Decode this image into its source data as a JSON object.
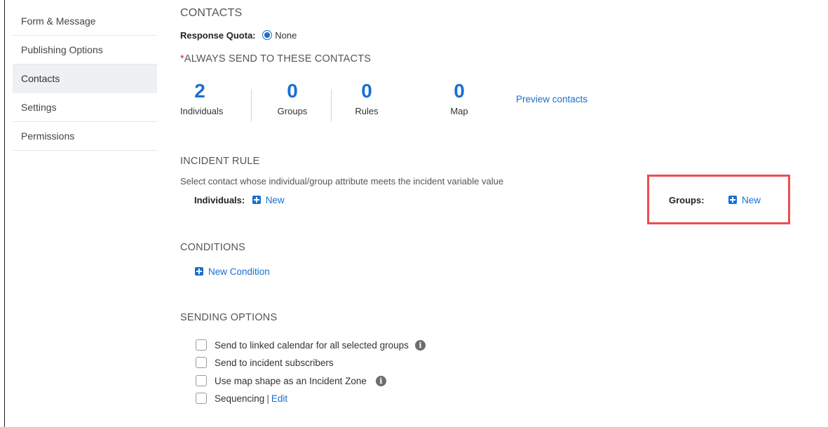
{
  "sidebar": {
    "items": [
      {
        "label": "Form & Message",
        "active": false
      },
      {
        "label": "Publishing Options",
        "active": false
      },
      {
        "label": "Contacts",
        "active": true
      },
      {
        "label": "Settings",
        "active": false
      },
      {
        "label": "Permissions",
        "active": false
      }
    ]
  },
  "contacts": {
    "title": "CONTACTS",
    "response_quota_label": "Response Quota:",
    "response_quota_value": "None"
  },
  "always_send": {
    "required_mark": "*",
    "title": "ALWAYS SEND TO THESE CONTACTS",
    "stats": [
      {
        "value": "2",
        "label": "Individuals"
      },
      {
        "value": "0",
        "label": "Groups"
      },
      {
        "value": "0",
        "label": "Rules"
      },
      {
        "value": "0",
        "label": "Map"
      }
    ],
    "preview_link": "Preview contacts"
  },
  "incident_rule": {
    "title": "INCIDENT RULE",
    "description": "Select contact whose individual/group attribute meets the incident variable value",
    "individuals_label": "Individuals:",
    "individuals_new": "New",
    "groups_label": "Groups:",
    "groups_new": "New"
  },
  "conditions": {
    "title": "CONDITIONS",
    "new_condition": "New Condition"
  },
  "sending_options": {
    "title": "SENDING OPTIONS",
    "options": [
      {
        "label": "Send to linked calendar for all selected groups",
        "checked": false,
        "info": true
      },
      {
        "label": "Send to incident subscribers",
        "checked": false,
        "info": false
      },
      {
        "label": "Use map shape as an Incident Zone",
        "checked": false,
        "info": true
      },
      {
        "label": "Sequencing",
        "checked": false,
        "info": false
      }
    ],
    "sequencing_separator": "|",
    "sequencing_edit": "Edit"
  },
  "icons": {
    "add": "plus-square-icon",
    "info": "info-circle-icon"
  },
  "colors": {
    "accent": "#1a6fd1",
    "highlight": "#ef4b52",
    "required": "#d62828"
  }
}
